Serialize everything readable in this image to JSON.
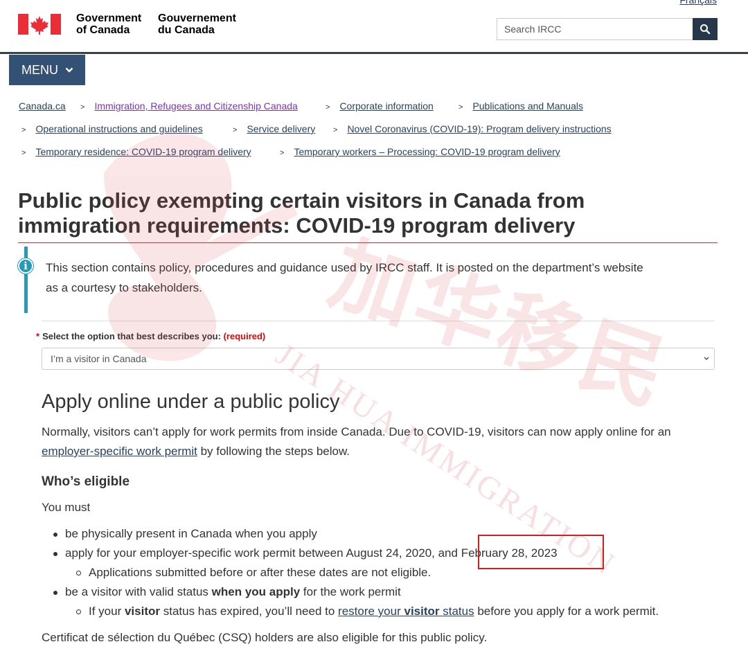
{
  "header": {
    "language_link": "Français",
    "wordmark_en_line1": "Government",
    "wordmark_en_line2": "of Canada",
    "wordmark_fr_line1": "Gouvernement",
    "wordmark_fr_line2": "du Canada",
    "search_placeholder": "Search IRCC",
    "search_icon": "search-icon",
    "flag_icon": "maple-leaf-flag-icon"
  },
  "menu": {
    "label": "MENU",
    "icon": "chevron-down-icon"
  },
  "breadcrumb": [
    {
      "label": "Canada.ca",
      "visited": false
    },
    {
      "label": "Immigration, Refugees and Citizenship Canada",
      "visited": true
    },
    {
      "label": "Corporate information",
      "visited": false
    },
    {
      "label": "Publications and Manuals",
      "visited": false
    },
    {
      "label": "Operational instructions and guidelines",
      "visited": false
    },
    {
      "label": "Service delivery",
      "visited": false
    },
    {
      "label": "Novel Coronavirus (COVID-19): Program delivery instructions",
      "visited": false
    },
    {
      "label": "Temporary residence: COVID-19 program delivery",
      "visited": false
    },
    {
      "label": "Temporary workers – Processing: COVID-19 program delivery",
      "visited": false
    }
  ],
  "page": {
    "title_line1": "Public policy exempting certain visitors in Canada from",
    "title_line2": "immigration requirements: COVID-19 program delivery",
    "info_line1": "This section contains policy, procedures and guidance used by IRCC staff. It is posted on the department’s website",
    "info_line2": "as a courtesy to stakeholders.",
    "select_label": "Select the option that best describes you:",
    "select_required": "(required)",
    "select_value": "I’m a visitor in Canada",
    "section_heading": "Apply online under a public policy",
    "intro_line1": "Normally, visitors can’t apply for work permits from inside Canada. Due to COVID-19, visitors can now apply online for an",
    "intro_link": "employer-specific work permit",
    "intro_line2_rest": " by following the steps below.",
    "eligible_heading": "Who’s eligible",
    "you_must": "You must",
    "bullet1": "be physically present in Canada when you apply",
    "bullet2": "apply for your employer-specific work permit between August 24, 2020, and February 28, 2023",
    "bullet2_sub": "Applications submitted before or after these dates are not eligible.",
    "bullet3_pre": "be a visitor with valid status ",
    "bullet3_bold": "when you apply",
    "bullet3_post": " for the work permit",
    "bullet3_sub_pre": "If your ",
    "bullet3_sub_bold": "visitor",
    "bullet3_sub_mid": " status has expired, you’ll need to ",
    "bullet3_sub_link_pre": "restore your ",
    "bullet3_sub_link_bold": "visitor",
    "bullet3_sub_link_post": " status",
    "bullet3_sub_post": " before you apply for a work permit.",
    "csq_text": "Certificat de sélection du Québec (CSQ) holders are also eligible for this public policy."
  },
  "watermark": {
    "latin": "JIA HUA IMMIGRATION",
    "chinese": "加华移民"
  },
  "colors": {
    "accent": "#26374a",
    "menu": "#335075",
    "link": "#284162",
    "visited": "#7834bc",
    "rule": "#af3c43",
    "info": "#269abc",
    "highlight": "#d02020"
  }
}
